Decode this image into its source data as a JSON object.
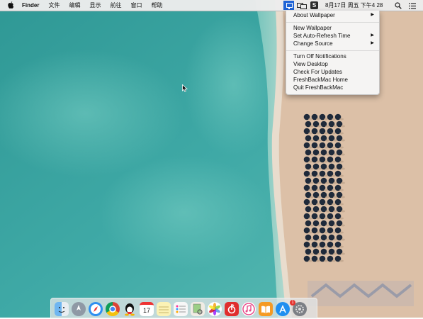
{
  "menubar": {
    "apple_glyph": "",
    "items": [
      "Finder",
      "文件",
      "编辑",
      "显示",
      "前往",
      "窗口",
      "帮助"
    ],
    "clock": "8月17日 周五 下午4 28",
    "status_s_label": "S"
  },
  "dropdown": {
    "about": "About Wallpaper",
    "new_wallpaper": "New Wallpaper",
    "auto_refresh": "Set Auto-Refresh Time",
    "change_source": "Change Source",
    "turn_off_notifications": "Turn Off Notifications",
    "view_desktop": "View Desktop",
    "check_updates": "Check For Updates",
    "home": "FreshBackMac Home",
    "quit": "Quit FreshBackMac",
    "submenu_arrow": "▶"
  },
  "dock": {
    "calendar_day": "17",
    "app_store_badge": "1"
  },
  "colors": {
    "sea": "#3aa4a2",
    "sand": "#dbbfa6",
    "menu_highlight": "#1f64d6",
    "badge": "#e5322d"
  }
}
